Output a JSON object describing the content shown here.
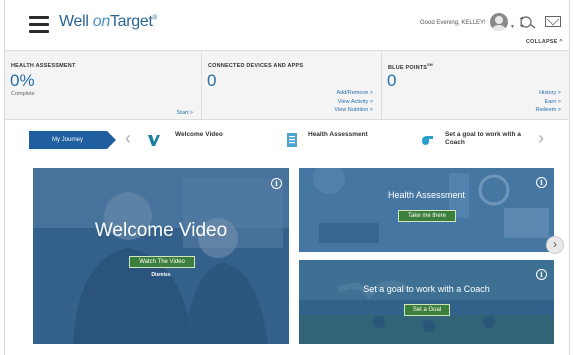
{
  "header": {
    "logo_prefix": "Well ",
    "logo_on": "on",
    "logo_suffix": "Target",
    "logo_tm": "®",
    "greeting": "Good Evening, KELLEY!",
    "collapse_label": "COLLAPSE ^"
  },
  "stats": {
    "health_assessment": {
      "title": "HEALTH ASSESSMENT",
      "value": "0%",
      "sub": "Complete",
      "link": "Start >"
    },
    "connected_devices": {
      "title": "CONNECTED DEVICES AND APPS",
      "value": "0",
      "links": [
        "Add/Remove >",
        "View Activity >",
        "View Nutrition >"
      ]
    },
    "blue_points": {
      "title": "BLUE POINTS",
      "title_mark": "SM",
      "value": "0",
      "links": [
        "History >",
        "Earn >",
        "Redeem >"
      ]
    }
  },
  "journey": {
    "my_journey_label": "My Journey",
    "prev_arrow": "‹",
    "next_arrow": "›",
    "steps": [
      {
        "label": "Welcome Video",
        "icon": "v-logo-icon"
      },
      {
        "label": "Health Assessment",
        "icon": "document-icon"
      },
      {
        "label": "Set a goal to work with a Coach",
        "icon": "whistle-icon"
      }
    ]
  },
  "cards": {
    "welcome": {
      "title": "Welcome Video",
      "button": "Watch The Video",
      "caption": "Dismiss",
      "info": "i"
    },
    "health": {
      "title": "Health Assessment",
      "button": "Take me there",
      "info": "i"
    },
    "goal": {
      "title": "Set a goal to work with a Coach",
      "button": "Set a Goal",
      "info": "i"
    },
    "next_arrow": "›"
  },
  "colors": {
    "brand_blue": "#1f5fa0",
    "value_blue": "#2a6ea8",
    "button_green": "#3c7f3c"
  }
}
